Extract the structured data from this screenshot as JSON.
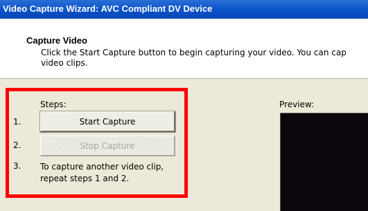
{
  "window": {
    "title": "Video Capture Wizard: AVC Compliant DV Device"
  },
  "header": {
    "title": "Capture Video",
    "description_line1": "Click the Start Capture button to begin capturing your video. You can cap",
    "description_line2": "video clips."
  },
  "steps": {
    "label": "Steps:",
    "step1_number": "1.",
    "step2_number": "2.",
    "step3_number": "3.",
    "start_capture_label": "Start Capture",
    "stop_capture_label": "Stop Capture",
    "step3_line1": "To capture another video clip,",
    "step3_line2": "repeat steps 1 and 2."
  },
  "preview": {
    "label": "Preview:"
  },
  "colors": {
    "titlebar": "#0a52c8",
    "highlight": "#ff0000",
    "preview_background": "#0b060b"
  }
}
